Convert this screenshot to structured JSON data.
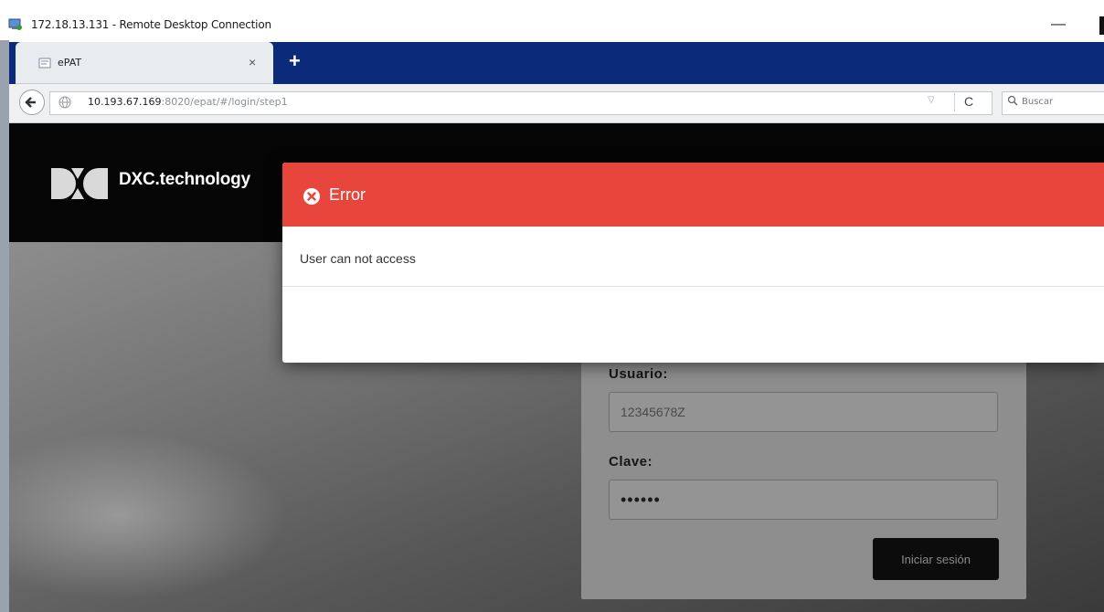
{
  "window": {
    "title": "172.18.13.131 - Remote Desktop Connection",
    "minimize_glyph": "—"
  },
  "browser": {
    "tab": {
      "title": "ePAT",
      "close_glyph": "×"
    },
    "new_tab_glyph": "+",
    "url_host": "10.193.67.169",
    "url_rest": ":8020/epat/#/login/step1",
    "search_placeholder": "Buscar",
    "reload_glyph": "C",
    "dropdown_glyph": "▽"
  },
  "header": {
    "brand": "DXC.technology"
  },
  "login": {
    "user_label": "Usuario:",
    "user_value": "12345678Z",
    "password_label": "Clave:",
    "password_value": "••••••",
    "submit_label": "Iniciar sesión"
  },
  "error_modal": {
    "title": "Error",
    "message": "User can not access"
  },
  "colors": {
    "tabbar": "#0b2a7a",
    "modal_header": "#e8453c",
    "header_bg": "#050505"
  }
}
